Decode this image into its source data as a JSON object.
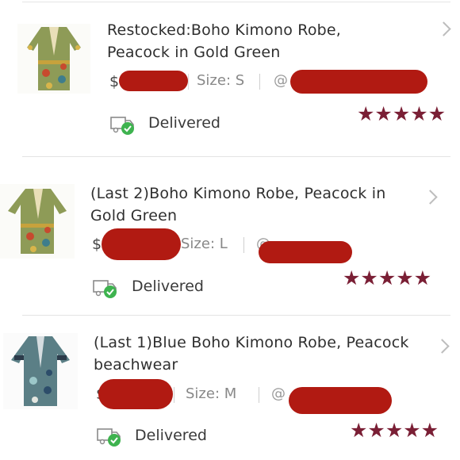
{
  "colors": {
    "accent_redaction": "#b11a12",
    "star": "#7a1f35",
    "check": "#3eb34f"
  },
  "orders": [
    {
      "title": "Restocked:Boho Kimono Robe, Peacock in Gold Green",
      "price_symbol": "$",
      "size_label": "Size: S",
      "seller_prefix": "@",
      "status": "Delivered",
      "rating": "★★★★★",
      "thumb_icon": "kimono-thumbnail-gold-green"
    },
    {
      "title": "(Last 2)Boho Kimono Robe, Peacock in Gold Green",
      "price_symbol": "$",
      "size_label": "Size: L",
      "seller_prefix": "@",
      "status": "Delivered",
      "rating": "★★★★★",
      "thumb_icon": "kimono-thumbnail-gold-green"
    },
    {
      "title": "(Last 1)Blue Boho Kimono Robe, Peacock beachwear",
      "price_symbol": "$",
      "size_label": "Size: M",
      "seller_prefix": "@",
      "status": "Delivered",
      "rating": "★★★★★",
      "thumb_icon": "kimono-thumbnail-blue"
    }
  ]
}
